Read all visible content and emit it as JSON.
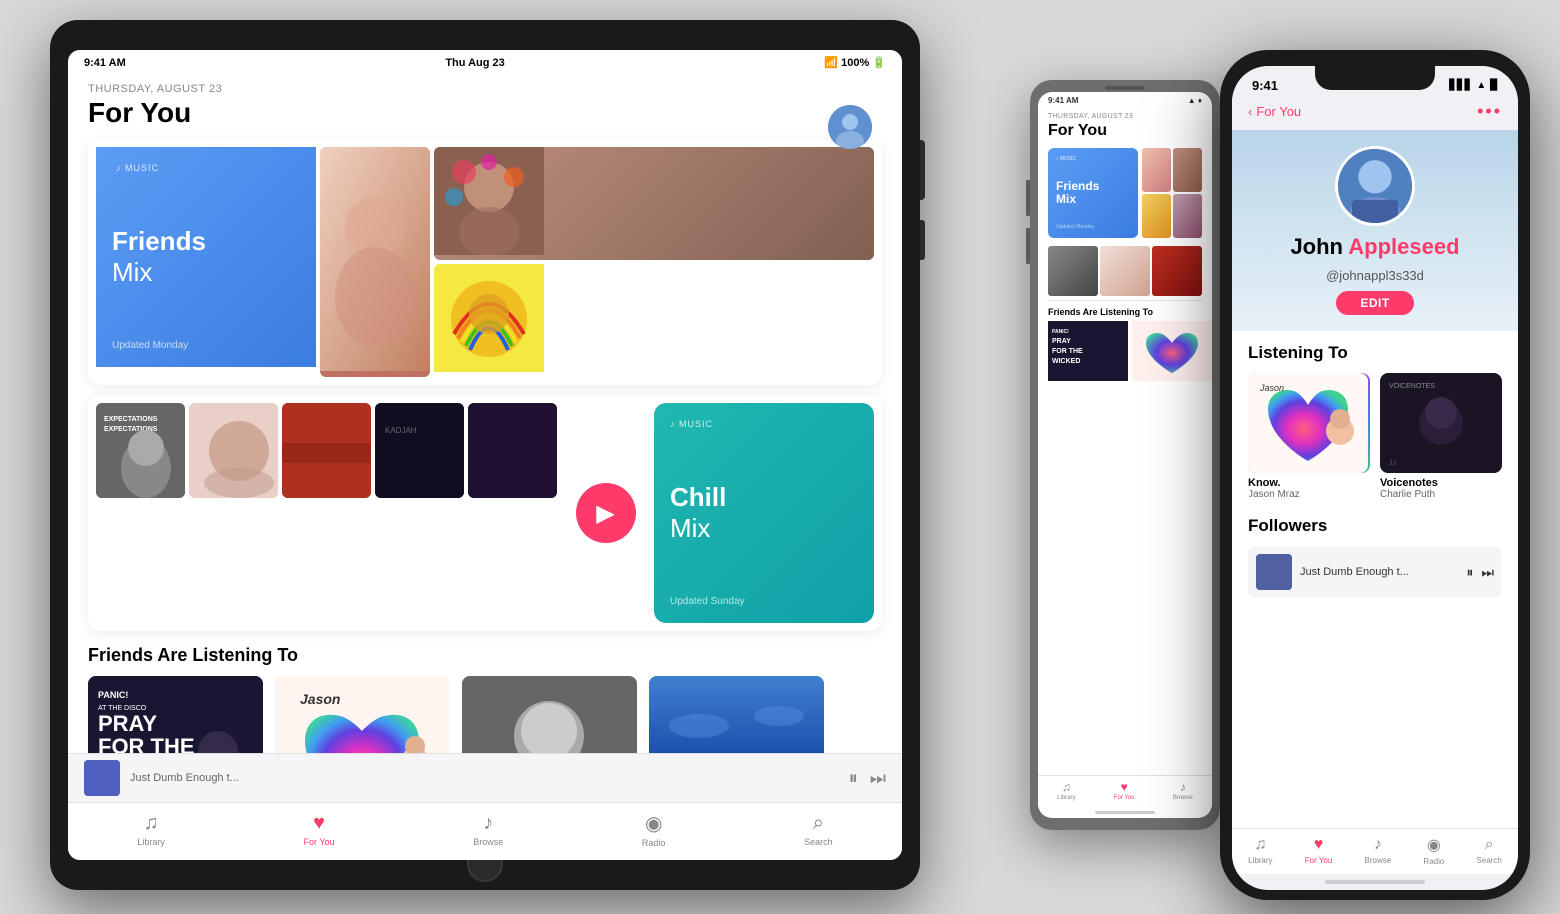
{
  "scene": {
    "background": "#d8d8d8"
  },
  "ipad": {
    "status": {
      "time": "9:41 AM",
      "date": "Thu Aug 23",
      "wifi": "WiFi",
      "battery": "100%"
    },
    "date_label": "THURSDAY, AUGUST 23",
    "page_title": "For You",
    "mixes": [
      {
        "id": "friends-mix",
        "brand": "♪ MUSIC",
        "title_bold": "Friends",
        "title_normal": "Mix",
        "updated": "Updated Monday",
        "style": "blue"
      },
      {
        "id": "chill-mix",
        "brand": "♪ MUSIC",
        "title_bold": "Chill",
        "title_normal": "Mix",
        "updated": "Updated Sunday",
        "style": "teal"
      }
    ],
    "section_friends": "Friends Are Listening To",
    "tabs": [
      {
        "label": "Library",
        "icon": "♫",
        "active": false
      },
      {
        "label": "For You",
        "icon": "♥",
        "active": true
      },
      {
        "label": "Browse",
        "icon": "♪",
        "active": false
      },
      {
        "label": "Radio",
        "icon": "◉",
        "active": false
      },
      {
        "label": "Search",
        "icon": "⌕",
        "active": false
      }
    ],
    "now_playing": "Just Dumb Enough t..."
  },
  "iphone_small": {
    "status": {
      "time": "9:41 AM"
    },
    "date_label": "THURSDAY, AUGUST 23",
    "page_title": "For You",
    "section_friends": "Friends Are Listening To",
    "tabs": [
      {
        "label": "Library",
        "icon": "♫",
        "active": false
      },
      {
        "label": "For You",
        "icon": "♥",
        "active": true
      },
      {
        "label": "Browse",
        "icon": "♪",
        "active": false
      }
    ]
  },
  "iphone_x": {
    "status": {
      "time": "9:41",
      "signal": "●●●",
      "wifi": "WiFi",
      "battery": "100%"
    },
    "nav": {
      "back_label": "For You",
      "more_icon": "•••"
    },
    "profile": {
      "name_black": "John ",
      "name_red": "Appleseed",
      "handle": "@johnappl3s33d",
      "edit_label": "EDIT"
    },
    "listening_to_title": "Listening To",
    "albums": [
      {
        "title": "Know.",
        "artist": "Jason Mraz",
        "style": "colorful"
      },
      {
        "title": "Voicenotes",
        "artist": "Charlie Puth",
        "style": "dark"
      }
    ],
    "followers_title": "Followers",
    "now_playing": "Just Dumb Enough t...",
    "tabs": [
      {
        "label": "Library",
        "icon": "♫",
        "active": false
      },
      {
        "label": "For You",
        "icon": "♥",
        "active": true
      },
      {
        "label": "Browse",
        "icon": "♪",
        "active": false
      },
      {
        "label": "Radio",
        "icon": "◉",
        "active": false
      },
      {
        "label": "Search",
        "icon": "⌕",
        "active": false
      }
    ]
  }
}
